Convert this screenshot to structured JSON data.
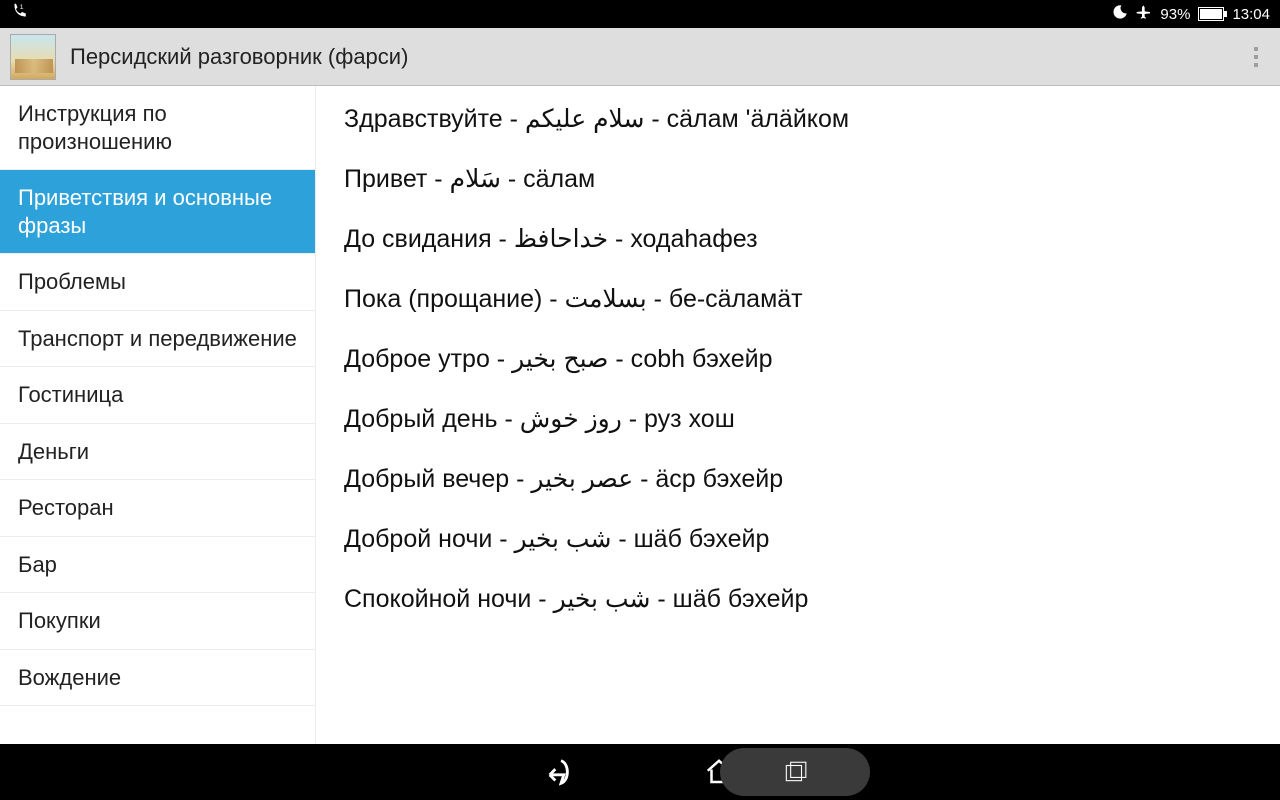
{
  "status": {
    "battery_pct": "93%",
    "time": "13:04"
  },
  "header": {
    "title": "Персидский разговорник (фарси)"
  },
  "sidebar": {
    "selected_index": 1,
    "items": [
      {
        "label": "Инструкция по произношению"
      },
      {
        "label": "Приветствия и основные фразы"
      },
      {
        "label": "Проблемы"
      },
      {
        "label": "Транспорт и передвижение"
      },
      {
        "label": "Гостиница"
      },
      {
        "label": "Деньги"
      },
      {
        "label": "Ресторан"
      },
      {
        "label": "Бар"
      },
      {
        "label": "Покупки"
      },
      {
        "label": "Вождение"
      }
    ]
  },
  "content": {
    "phrases": [
      "Здравствуйте - سلام عليكم - сӓлам 'ӓлӓйком",
      "Привет - سَلام - сӓлам",
      "До свидания - خداحافظ - ходаhафез",
      "Пока (прощание) - بسلامت - бе-сӓламӓт",
      "Доброе утро - صبح بخير - соbh бэхейр",
      "Добрый день - روز خوش - руз хош",
      "Добрый вечер - عصر بخير - ӓср бэхейр",
      "Доброй ночи - شب بخير - шӓб бэхейр",
      "Спокойной ночи - شب بخير - шӓб бэхейр"
    ]
  }
}
